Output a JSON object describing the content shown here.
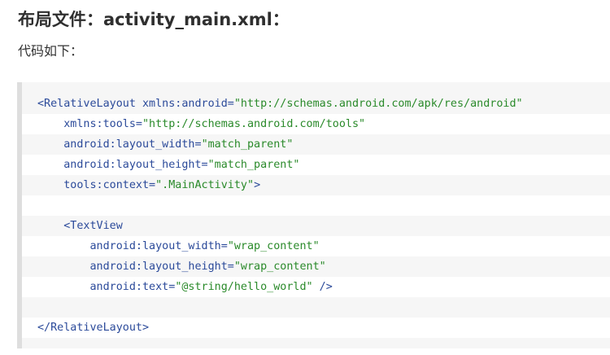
{
  "heading": "布局文件：activity_main.xml：",
  "intro": "代码如下：",
  "code_lines": [
    {
      "indent": "",
      "parts": [
        [
          "tag",
          "<RelativeLayout "
        ],
        [
          "attr",
          "xmlns:android="
        ],
        [
          "val",
          "\"http://schemas.android.com/apk/res/android\""
        ]
      ]
    },
    {
      "indent": "    ",
      "parts": [
        [
          "attr",
          "xmlns:tools="
        ],
        [
          "val",
          "\"http://schemas.android.com/tools\""
        ]
      ]
    },
    {
      "indent": "    ",
      "parts": [
        [
          "attr",
          "android:layout_width="
        ],
        [
          "val",
          "\"match_parent\""
        ]
      ]
    },
    {
      "indent": "    ",
      "parts": [
        [
          "attr",
          "android:layout_height="
        ],
        [
          "val",
          "\"match_parent\""
        ]
      ]
    },
    {
      "indent": "    ",
      "parts": [
        [
          "attr",
          "tools:context="
        ],
        [
          "val",
          "\".MainActivity\""
        ],
        [
          "tag",
          ">"
        ]
      ]
    },
    {
      "indent": "",
      "parts": []
    },
    {
      "indent": "    ",
      "parts": [
        [
          "tag",
          "<TextView"
        ]
      ]
    },
    {
      "indent": "        ",
      "parts": [
        [
          "attr",
          "android:layout_width="
        ],
        [
          "val",
          "\"wrap_content\""
        ]
      ]
    },
    {
      "indent": "        ",
      "parts": [
        [
          "attr",
          "android:layout_height="
        ],
        [
          "val",
          "\"wrap_content\""
        ]
      ]
    },
    {
      "indent": "        ",
      "parts": [
        [
          "attr",
          "android:text="
        ],
        [
          "val",
          "\"@string/hello_world\""
        ],
        [
          "tag",
          " />"
        ]
      ]
    },
    {
      "indent": "",
      "parts": []
    },
    {
      "indent": "",
      "parts": [
        [
          "tag",
          "</RelativeLayout>"
        ]
      ]
    }
  ],
  "colors": {
    "tag": "#2b4a9a",
    "attr": "#2b4a9a",
    "value": "#2a8a2a",
    "code_background": "#f6f6f6",
    "code_border": "#dedede"
  }
}
